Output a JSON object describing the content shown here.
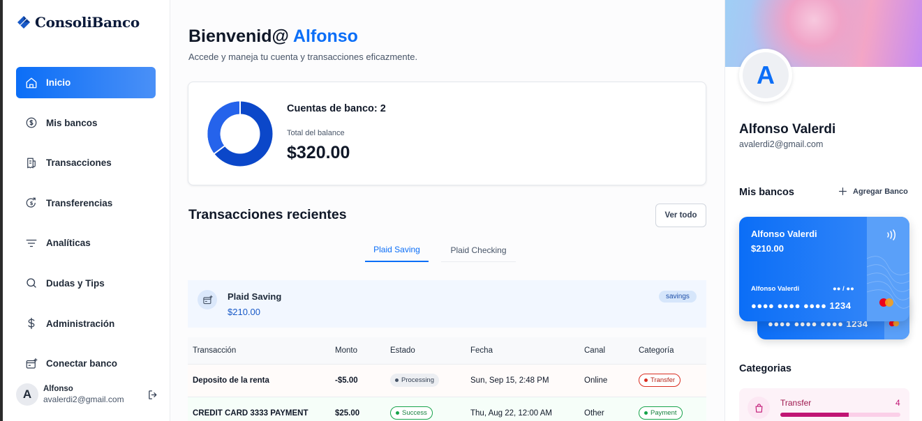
{
  "sidebar": {
    "brand": "ConsoliBanco",
    "items": [
      {
        "label": "Inicio",
        "icon": "home-icon"
      },
      {
        "label": "Mis bancos",
        "icon": "dollar-circle-icon"
      },
      {
        "label": "Transacciones",
        "icon": "receipt-icon"
      },
      {
        "label": "Transferencias",
        "icon": "transfer-icon"
      },
      {
        "label": "Analíticas",
        "icon": "filter-lines-icon"
      },
      {
        "label": "Dudas y Tips",
        "icon": "search-icon"
      },
      {
        "label": "Administración",
        "icon": "dollar-sign-icon"
      },
      {
        "label": "Conectar banco",
        "icon": "connect-bank-icon"
      }
    ],
    "user": {
      "initial": "A",
      "name": "Alfonso",
      "email": "avalerdi2@gmail.com"
    }
  },
  "main": {
    "greeting_prefix": "Bienvenid@",
    "greeting_name": "Alfonso",
    "subtitle": "Accede y maneja tu cuenta y transacciones eficazmente.",
    "balance": {
      "accounts_label": "Cuentas de banco: 2",
      "total_label": "Total del balance",
      "total_amount": "$320.00"
    },
    "recent": {
      "title": "Transacciones recientes",
      "view_all": "Ver todo",
      "tabs": [
        "Plaid Saving",
        "Plaid Checking"
      ],
      "active_tab": 0,
      "bank": {
        "name": "Plaid Saving",
        "amount": "$210.00",
        "badge": "savings"
      },
      "columns": [
        "Transacción",
        "Monto",
        "Estado",
        "Fecha",
        "Canal",
        "Categoría"
      ],
      "rows": [
        {
          "name": "Deposito de la renta",
          "amount": "-$5.00",
          "status": "Processing",
          "date": "Sun, Sep 15, 2:48 PM",
          "channel": "Online",
          "category": "Transfer"
        },
        {
          "name": "CREDIT CARD 3333 PAYMENT",
          "amount": "$25.00",
          "status": "Success",
          "date": "Thu, Aug 22, 12:00 AM",
          "channel": "Other",
          "category": "Payment"
        }
      ]
    }
  },
  "right": {
    "profile": {
      "initial": "A",
      "name": "Alfonso Valerdi",
      "email": "avalerdi2@gmail.com"
    },
    "banks_title": "Mis bancos",
    "add_bank": "Agregar Banco",
    "card": {
      "holder": "Alfonso Valerdi",
      "amount": "$210.00",
      "holder_small": "Alfonso Valerdi",
      "expiry": "●● / ●●",
      "number": "●●●● ●●●● ●●●● 1234"
    },
    "card_back": {
      "number": "●●●● ●●●● ●●●● 1234"
    },
    "categories_title": "Categorias",
    "categories": [
      {
        "name": "Transfer",
        "count": "4",
        "progress": 0.57
      }
    ]
  },
  "colors": {
    "accent": "#0b6ef7",
    "donut_dark": "#0b47c9",
    "donut_light": "#2563eb",
    "negative": "#e04f3f",
    "positive": "#16a34a",
    "category_pink": "#c11574"
  }
}
